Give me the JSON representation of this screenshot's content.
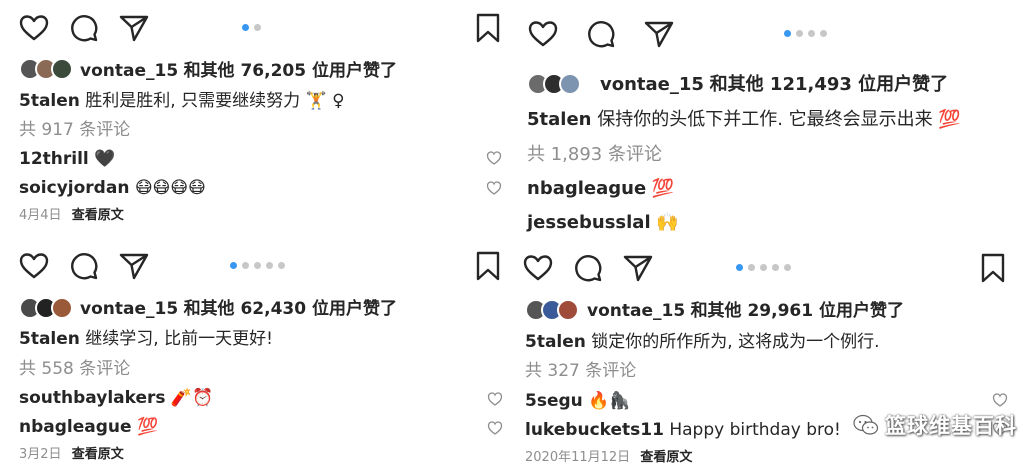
{
  "panels": [
    {
      "likes_text": "和其他 76,205 位用户赞了",
      "liker": "vontae_15",
      "caption_user": "5talen",
      "caption": "胜利是胜利, 只需要继续努力 🏋 ♀",
      "comments_count": "共 917 条评论",
      "comments": [
        {
          "user": "12thrill",
          "text": "🖤"
        },
        {
          "user": "soicyjordan",
          "text": "😷😷😷😷"
        }
      ],
      "date": "4月4日",
      "view_original": "查看原文",
      "carousel": {
        "total": 2,
        "active": 0
      }
    },
    {
      "likes_text": "和其他 121,493 位用户赞了",
      "liker": "vontae_15",
      "caption_user": "5talen",
      "caption": "保持你的头低下并工作. 它最终会显示出来 💯",
      "comments_count": "共 1,893 条评论",
      "comments": [
        {
          "user": "nbagleague",
          "text": "💯"
        },
        {
          "user": "jessebusslal",
          "text": "🙌"
        }
      ],
      "carousel": {
        "total": 4,
        "active": 0
      }
    },
    {
      "likes_text": "和其他 62,430 位用户赞了",
      "liker": "vontae_15",
      "caption_user": "5talen",
      "caption": "继续学习, 比前一天更好!",
      "comments_count": "共 558 条评论",
      "comments": [
        {
          "user": "southbaylakers",
          "text": "🧨⏰"
        },
        {
          "user": "nbagleague",
          "text": "💯"
        }
      ],
      "date": "3月2日",
      "view_original": "查看原文",
      "carousel": {
        "total": 5,
        "active": 0
      }
    },
    {
      "likes_text": "和其他 29,961 位用户赞了",
      "liker": "vontae_15",
      "caption_user": "5talen",
      "caption": "锁定你的所作所为, 这将成为一个例行.",
      "comments_count": "共 327 条评论",
      "comments": [
        {
          "user": "5segu",
          "text": "🔥🦍"
        },
        {
          "user": "lukebuckets11",
          "text": "Happy birthday bro!"
        }
      ],
      "date": "2020年11月12日",
      "view_original": "查看原文",
      "carousel": {
        "total": 5,
        "active": 0
      }
    }
  ],
  "watermark": "篮球维基百科",
  "icons": {
    "like": "heart-icon",
    "comment": "comment-icon",
    "share": "send-icon",
    "save": "bookmark-icon",
    "comment_like": "small-heart-icon",
    "watermark_logo": "wechat-logo-icon"
  },
  "colors": {
    "text": "#262626",
    "muted": "#8e8e8e",
    "carousel_active": "#3897f0",
    "carousel_inactive": "#c7c7c7",
    "hundred_emoji": "#e0245e"
  }
}
